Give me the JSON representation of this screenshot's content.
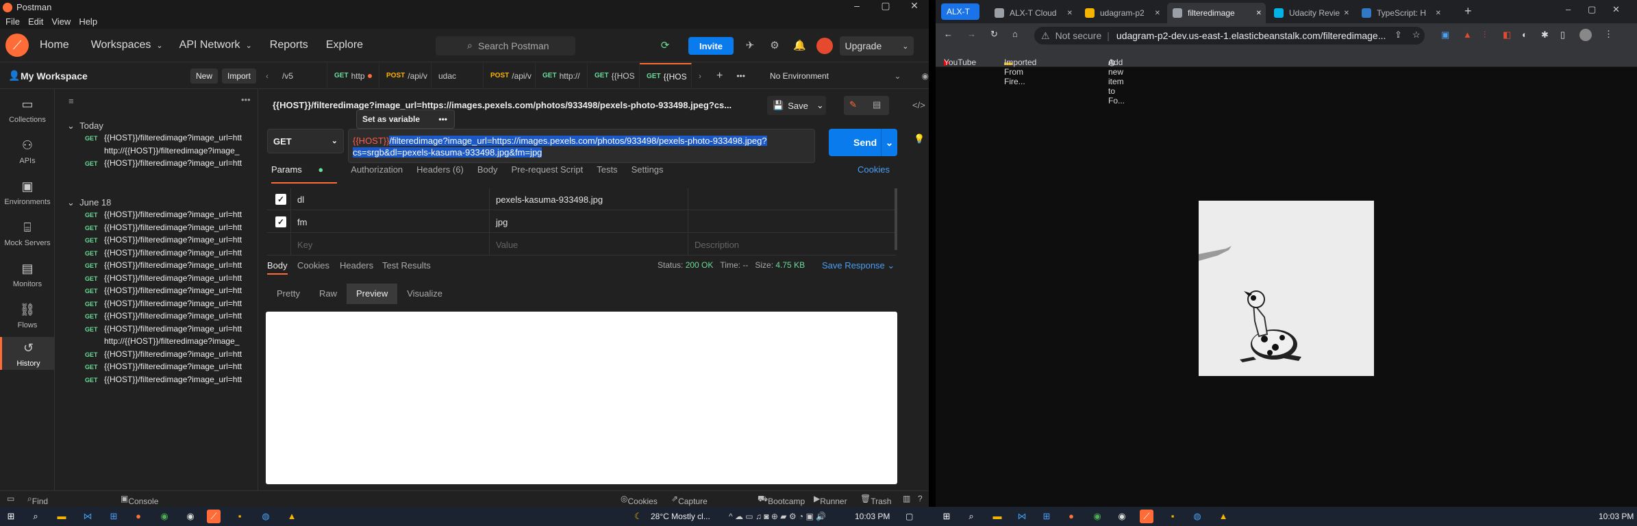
{
  "postman": {
    "window_title": "Postman",
    "menu": [
      "File",
      "Edit",
      "View",
      "Help"
    ],
    "nav": {
      "home": "Home",
      "workspaces": "Workspaces",
      "api_network": "API Network",
      "reports": "Reports",
      "explore": "Explore"
    },
    "search_placeholder": "Search Postman",
    "invite": "Invite",
    "upgrade": "Upgrade",
    "workspace_name": "My Workspace",
    "new_btn": "New",
    "import_btn": "Import",
    "rail": [
      {
        "label": "Collections",
        "icon": "collections-icon"
      },
      {
        "label": "APIs",
        "icon": "apis-icon"
      },
      {
        "label": "Environments",
        "icon": "environments-icon"
      },
      {
        "label": "Mock Servers",
        "icon": "mock-servers-icon"
      },
      {
        "label": "Monitors",
        "icon": "monitors-icon"
      },
      {
        "label": "Flows",
        "icon": "flows-icon"
      },
      {
        "label": "History",
        "icon": "history-icon"
      }
    ],
    "history": {
      "today_label": "Today",
      "today": [
        {
          "method": "GET",
          "url": "{{HOST}}/filteredimage?image_url=htt"
        },
        {
          "method": "",
          "url": "http://{{HOST}}/filteredimage?image_"
        },
        {
          "method": "GET",
          "url": "{{HOST}}/filteredimage?image_url=htt"
        }
      ],
      "june_label": "June 18",
      "june": [
        {
          "method": "GET",
          "url": "{{HOST}}/filteredimage?image_url=htt"
        },
        {
          "method": "GET",
          "url": "{{HOST}}/filteredimage?image_url=htt"
        },
        {
          "method": "GET",
          "url": "{{HOST}}/filteredimage?image_url=htt"
        },
        {
          "method": "GET",
          "url": "{{HOST}}/filteredimage?image_url=htt"
        },
        {
          "method": "GET",
          "url": "{{HOST}}/filteredimage?image_url=htt"
        },
        {
          "method": "GET",
          "url": "{{HOST}}/filteredimage?image_url=htt"
        },
        {
          "method": "GET",
          "url": "{{HOST}}/filteredimage?image_url=htt"
        },
        {
          "method": "GET",
          "url": "{{HOST}}/filteredimage?image_url=htt"
        },
        {
          "method": "GET",
          "url": "{{HOST}}/filteredimage?image_url=htt"
        },
        {
          "method": "GET",
          "url": "{{HOST}}/filteredimage?image_url=htt"
        },
        {
          "method": "",
          "url": "http://{{HOST}}/filteredimage?image_"
        },
        {
          "method": "GET",
          "url": "{{HOST}}/filteredimage?image_url=htt"
        },
        {
          "method": "GET",
          "url": "{{HOST}}/filteredimage?image_url=htt"
        },
        {
          "method": "GET",
          "url": "{{HOST}}/filteredimage?image_url=htt"
        }
      ]
    },
    "tabs": [
      {
        "method": "",
        "label": "/v5",
        "mclass": ""
      },
      {
        "method": "GET",
        "label": "http",
        "mclass": "g",
        "dot": true
      },
      {
        "method": "POST",
        "label": "/api/v",
        "mclass": "p"
      },
      {
        "method": "",
        "label": "udac",
        "mclass": ""
      },
      {
        "method": "POST",
        "label": "/api/v",
        "mclass": "p"
      },
      {
        "method": "GET",
        "label": "http://",
        "mclass": "g"
      },
      {
        "method": "GET",
        "label": "{{HOS",
        "mclass": "g"
      },
      {
        "method": "GET",
        "label": "{{HOS",
        "mclass": "g",
        "active": true
      }
    ],
    "environment": "No Environment",
    "request_name": "{{HOST}}/filteredimage?image_url=https://images.pexels.com/photos/933498/pexels-photo-933498.jpeg?cs...",
    "save": "Save",
    "method": "GET",
    "url": {
      "host": "{{HOST}}",
      "line1": "/filteredimage?image_url=https://images.pexels.com/photos/933498/pexels-photo-933498.jpeg?",
      "line2": "cs=srgb&dl=pexels-kasuma-933498.jpg&fm=jpg"
    },
    "tooltip": "Set as variable",
    "send": "Send",
    "req_tabs": {
      "params": "Params",
      "auth": "Authorization",
      "headers": "Headers (6)",
      "body": "Body",
      "prereq": "Pre-request Script",
      "tests": "Tests",
      "settings": "Settings",
      "cookies": "Cookies"
    },
    "params": [
      {
        "key": "dl",
        "value": "pexels-kasuma-933498.jpg",
        "checked": true
      },
      {
        "key": "fm",
        "value": "jpg",
        "checked": true
      }
    ],
    "params_placeholder": {
      "key": "Key",
      "value": "Value",
      "desc": "Description"
    },
    "res_tabs": {
      "body": "Body",
      "cookies": "Cookies",
      "headers": "Headers",
      "results": "Test Results"
    },
    "status": {
      "status_label": "Status:",
      "status": "200 OK",
      "time_label": "Time:",
      "time": "--",
      "size_label": "Size:",
      "size": "4.75 KB",
      "save_response": "Save Response"
    },
    "view_modes": [
      "Pretty",
      "Raw",
      "Preview",
      "Visualize"
    ],
    "footer": {
      "find": "Find and Replace",
      "console": "Console",
      "cookies": "Cookies",
      "capture": "Capture requests",
      "bootcamp": "Bootcamp",
      "runner": "Runner",
      "trash": "Trash"
    }
  },
  "chrome": {
    "tabs": [
      {
        "label": "ALX-T",
        "color": "#1a73e8"
      },
      {
        "label": "ALX-T Cloud",
        "color": "#9aa0a6"
      },
      {
        "label": "udagram-p2",
        "color": "#f4b400"
      },
      {
        "label": "filteredimage",
        "color": "#9aa0a6",
        "active": true
      },
      {
        "label": "Udacity Revie",
        "color": "#02b3e4"
      },
      {
        "label": "TypeScript: H",
        "color": "#3178c6"
      }
    ],
    "not_secure": "Not secure",
    "url": "udagram-p2-dev.us-east-1.elasticbeanstalk.com/filteredimage...",
    "bookmarks": [
      "YouTube",
      "Imported From Fire...",
      "Add new item to Fo..."
    ]
  },
  "taskbar": {
    "weather": "28°C  Mostly cl...",
    "time": "10:03 PM",
    "time2": "10:03 PM"
  }
}
